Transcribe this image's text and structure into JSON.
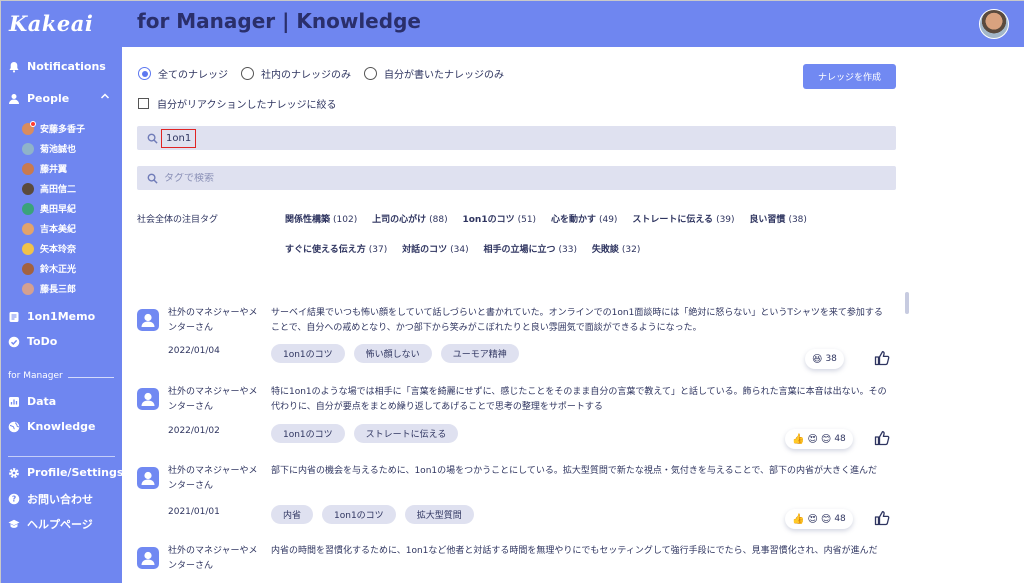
{
  "sidebar": {
    "logo": "Kakeai",
    "notifications": "Notifications",
    "people": "People",
    "people_list": [
      "安藤多香子",
      "菊池誠也",
      "藤井翼",
      "高田信二",
      "奥田早紀",
      "吉本美紀",
      "矢本玲奈",
      "鈴木正光",
      "藤長三郎"
    ],
    "onememo": "1on1Memo",
    "todo": "ToDo",
    "section": "for Manager",
    "data": "Data",
    "knowledge": "Knowledge",
    "profile": "Profile/Settings",
    "contact": "お問い合わせ",
    "help": "ヘルプページ"
  },
  "header": {
    "title": "for Manager | Knowledge"
  },
  "filters": {
    "all": "全てのナレッジ",
    "internal": "社内のナレッジのみ",
    "mine": "自分が書いたナレッジのみ",
    "reacted": "自分がリアクションしたナレッジに絞る",
    "create": "ナレッジを作成"
  },
  "search": {
    "query": "1on1",
    "tag_placeholder": "タグで検索"
  },
  "tags": {
    "label": "社会全体の注目タグ",
    "row1": [
      {
        "name": "関係性構築",
        "count": "(102)"
      },
      {
        "name": "上司の心がけ",
        "count": "(88)"
      },
      {
        "name": "1on1のコツ",
        "count": "(51)"
      },
      {
        "name": "心を動かす",
        "count": "(49)"
      },
      {
        "name": "ストレートに伝える",
        "count": "(39)"
      },
      {
        "name": "良い習慣",
        "count": "(38)"
      }
    ],
    "row2": [
      {
        "name": "すぐに使える伝え方",
        "count": "(37)"
      },
      {
        "name": "対話のコツ",
        "count": "(34)"
      },
      {
        "name": "相手の立場に立つ",
        "count": "(33)"
      },
      {
        "name": "失敗談",
        "count": "(32)"
      }
    ]
  },
  "cards": [
    {
      "author": "社外のマネジャーやメンターさん",
      "date": "2022/01/04",
      "body": "サーベイ結果でいつも怖い顔をしていて話しづらいと書かれていた。オンラインでの1on1面談時には「絶対に怒らない」というTシャツを来て参加することで、自分への戒めとなり、かつ部下から笑みがこぼれたりと良い雰囲気で面談ができるようになった。",
      "chips": [
        "1on1のコツ",
        "怖い顔しない",
        "ユーモア精神"
      ],
      "reactions": [
        "😆"
      ],
      "count": "38"
    },
    {
      "author": "社外のマネジャーやメンターさん",
      "date": "2022/01/02",
      "body": "特に1on1のような場では相手に「言葉を綺麗にせずに、感じたことをそのまま自分の言葉で教えて」と話している。飾られた言葉に本音は出ない。その代わりに、自分が要点をまとめ繰り返してあげることで思考の整理をサポートする",
      "chips": [
        "1on1のコツ",
        "ストレートに伝える"
      ],
      "reactions": [
        "👍",
        "😍",
        "😊"
      ],
      "count": "48"
    },
    {
      "author": "社外のマネジャーやメンターさん",
      "date": "2021/01/01",
      "body": "部下に内省の機会を与えるために、1on1の場をつかうことにしている。拡大型質問で新たな視点・気付きを与えることで、部下の内省が大きく進んだ",
      "chips": [
        "内省",
        "1on1のコツ",
        "拡大型質問"
      ],
      "reactions": [
        "👍",
        "😍",
        "😊"
      ],
      "count": "48"
    },
    {
      "author": "社外のマネジャーやメンターさん",
      "body": "内省の時間を習慣化するために、1on1など他者と対話する時間を無理やりにでもセッティングして強行手段にでたら、見事習慣化され、内省が進んだ"
    }
  ],
  "colors": {
    "sidebar": "#6f86f0",
    "accent": "#7189f2",
    "chip": "#dfe1f0",
    "text": "#2f3560"
  }
}
